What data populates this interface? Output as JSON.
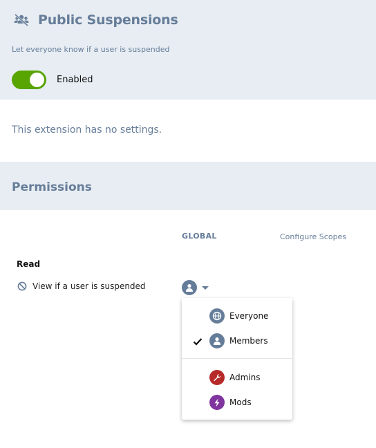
{
  "extension": {
    "title": "Public Suspensions",
    "icon": "users-slash-icon",
    "description": "Let everyone know if a user is suspended",
    "toggle_label": "Enabled",
    "enabled": true
  },
  "settings": {
    "empty_message": "This extension has no settings."
  },
  "permissions": {
    "title": "Permissions",
    "column_global": "GLOBAL",
    "configure_scopes": "Configure Scopes",
    "section_read": "Read",
    "rows": [
      {
        "icon": "ban-icon",
        "label": "View if a user is suspended",
        "selected_group": "Members"
      }
    ]
  },
  "group_dropdown": {
    "open": true,
    "items": [
      {
        "label": "Everyone",
        "icon": "globe-icon",
        "color": "#667d99",
        "checked": false
      },
      {
        "label": "Members",
        "icon": "user-icon",
        "color": "#667d99",
        "checked": true
      },
      {
        "label": "Admins",
        "icon": "wrench-icon",
        "color": "#b72a2a",
        "checked": false
      },
      {
        "label": "Mods",
        "icon": "bolt-icon",
        "color": "#80349e",
        "checked": false
      }
    ]
  },
  "colors": {
    "accent": "#667d99",
    "toggle_on": "#58a400",
    "header_bg": "#e7edf3"
  }
}
